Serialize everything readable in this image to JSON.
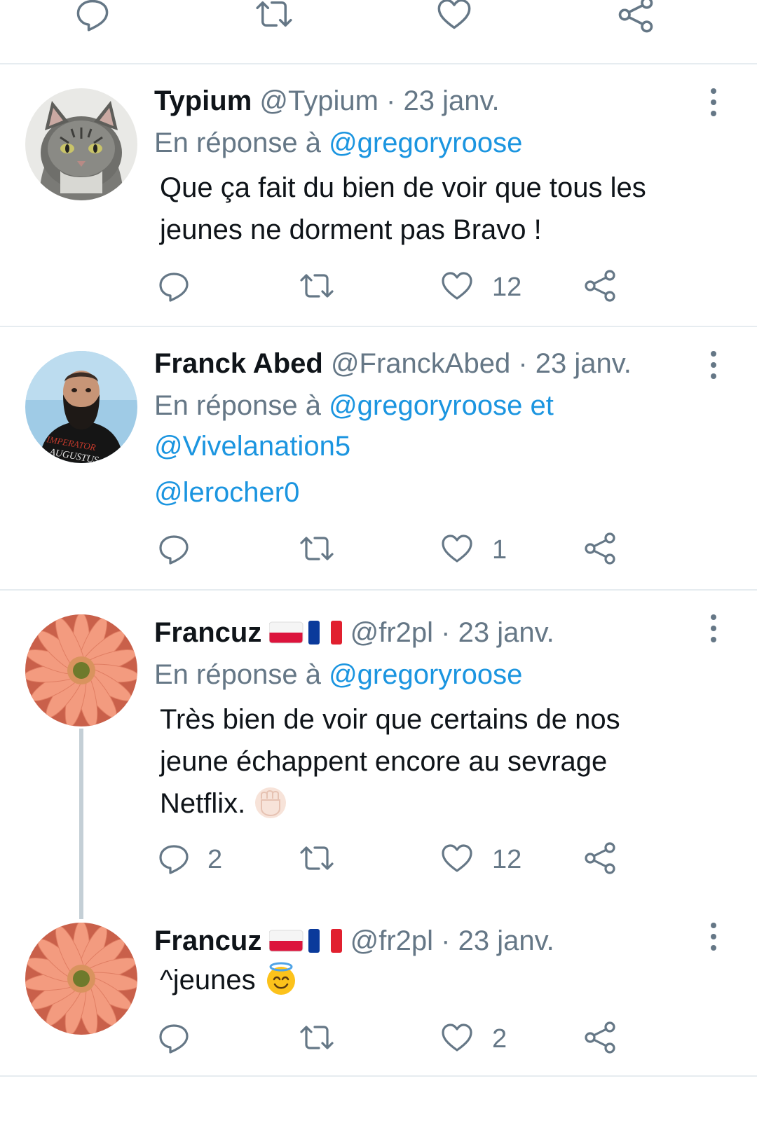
{
  "colors": {
    "link": "#1b95e0",
    "muted": "#657786",
    "text": "#0f1419",
    "divider": "#e6ecf0"
  },
  "icons": {
    "reply": "reply-icon",
    "retweet": "retweet-icon",
    "like": "heart-icon",
    "share": "share-icon",
    "more": "more-vertical-icon"
  },
  "tweets": [
    {
      "name": "Typium",
      "handle": "@Typium",
      "date": "· 23 janv.",
      "reply_prefix": "En réponse à",
      "reply_to": "@gregoryroose",
      "text_lines": [
        "Que ça fait du bien de voir que tous les",
        "jeunes ne dorment pas Bravo !"
      ],
      "likes": "12"
    },
    {
      "name": "Franck Abed",
      "handle": "@FranckAbed",
      "date": "· 23 janv.",
      "reply_prefix": "En réponse à",
      "reply_to": "@gregoryroose et",
      "reply_to_2": "@Vivelanation5",
      "mention": "@lerocher0",
      "avatar_shirt_text_1": "IMPERATOR",
      "avatar_shirt_text_2": "AUGUSTUS",
      "likes": "1"
    },
    {
      "name": "Francuz",
      "handle": "@fr2pl",
      "date": "· 23 janv.",
      "reply_prefix": "En réponse à",
      "reply_to": "@gregoryroose",
      "text_lines": [
        "Très bien de voir que certains de nos",
        "jeune échappent encore au sevrage",
        "Netflix."
      ],
      "replies": "2",
      "likes": "12"
    },
    {
      "name": "Francuz",
      "handle": "@fr2pl",
      "date": "· 23 janv.",
      "text_lines": [
        "^jeunes"
      ],
      "likes": "2"
    }
  ]
}
